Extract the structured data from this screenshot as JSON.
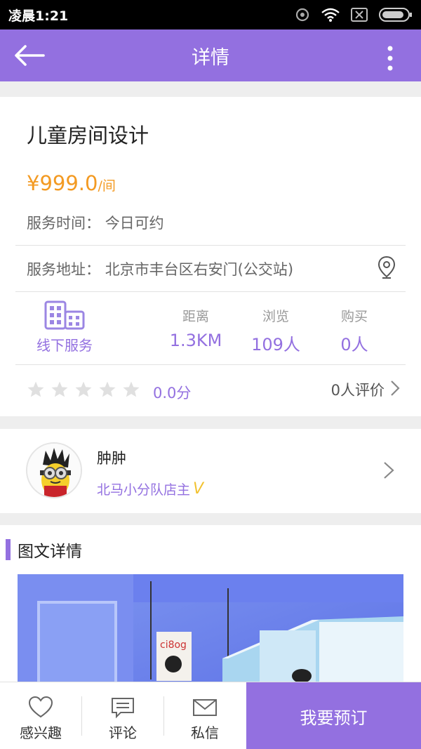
{
  "status_bar": {
    "time": "凌晨1:21"
  },
  "navbar": {
    "title": "详情"
  },
  "service": {
    "title": "儿童房间设计",
    "price": "¥999.0",
    "price_unit": "/间",
    "time_label": "服务时间：",
    "time_value": "今日可约",
    "address_label": "服务地址：",
    "address_value": "北京市丰台区右安门(公交站)"
  },
  "offline": {
    "label": "线下服务",
    "icon": "building-icon"
  },
  "stats": [
    {
      "label": "距离",
      "value": "1.3KM"
    },
    {
      "label": "浏览",
      "value": "109人"
    },
    {
      "label": "购买",
      "value": "0人"
    }
  ],
  "rating": {
    "stars": 0,
    "max_stars": 5,
    "score": "0.0分",
    "review_count": "0人评价"
  },
  "seller": {
    "name": "肿肿",
    "role": "北马小分队店主",
    "badge": "V"
  },
  "details": {
    "title": "图文详情"
  },
  "bottom_bar": {
    "tabs": [
      {
        "label": "感兴趣",
        "icon": "heart-icon"
      },
      {
        "label": "评论",
        "icon": "comment-icon"
      },
      {
        "label": "私信",
        "icon": "mail-icon"
      }
    ],
    "book_label": "我要预订"
  },
  "colors": {
    "accent": "#9370e0",
    "price": "#f39a22",
    "star_empty": "#e0e0e0"
  }
}
